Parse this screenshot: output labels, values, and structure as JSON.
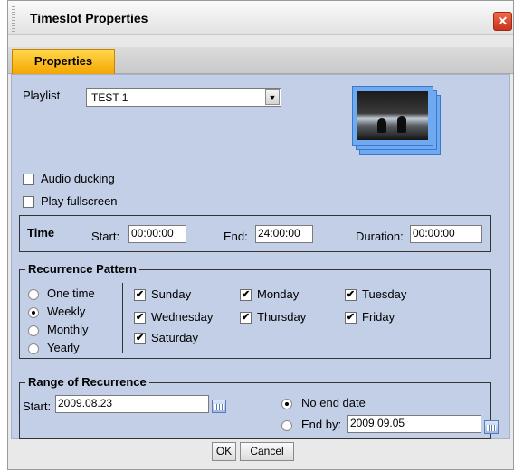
{
  "window": {
    "title": "Timeslot Properties",
    "close_glyph": "✕"
  },
  "tabs": [
    {
      "label": "Properties",
      "active": true
    }
  ],
  "playlist": {
    "label": "Playlist",
    "selected": "TEST 1"
  },
  "options": {
    "audio_ducking": {
      "label": "Audio ducking",
      "checked": false
    },
    "play_fullscreen": {
      "label": "Play fullscreen",
      "checked": false
    }
  },
  "time": {
    "legend": "Time",
    "start_label": "Start:",
    "start_value": "00:00:00",
    "end_label": "End:",
    "end_value": "24:00:00",
    "duration_label": "Duration:",
    "duration_value": "00:00:00"
  },
  "recurrence": {
    "legend": "Recurrence Pattern",
    "patterns": [
      {
        "label": "One time",
        "selected": false
      },
      {
        "label": "Weekly",
        "selected": true
      },
      {
        "label": "Monthly",
        "selected": false
      },
      {
        "label": "Yearly",
        "selected": false
      }
    ],
    "days": [
      {
        "label": "Sunday",
        "checked": true
      },
      {
        "label": "Monday",
        "checked": true
      },
      {
        "label": "Tuesday",
        "checked": true
      },
      {
        "label": "Wednesday",
        "checked": true
      },
      {
        "label": "Thursday",
        "checked": true
      },
      {
        "label": "Friday",
        "checked": true
      },
      {
        "label": "Saturday",
        "checked": true
      }
    ]
  },
  "range": {
    "legend": "Range of Recurrence",
    "start_label": "Start:",
    "start_value": "2009.08.23",
    "no_end_label": "No end date",
    "no_end_selected": true,
    "end_by_label": "End by:",
    "end_by_value": "2009.09.05",
    "end_by_selected": false
  },
  "buttons": {
    "ok": "OK",
    "cancel": "Cancel"
  },
  "icons": {
    "checkmark": "✔",
    "dropdown": "▼"
  },
  "colors": {
    "panel": "#c2cfe6",
    "tab_active": "#f5b800",
    "close": "#d9442a"
  }
}
